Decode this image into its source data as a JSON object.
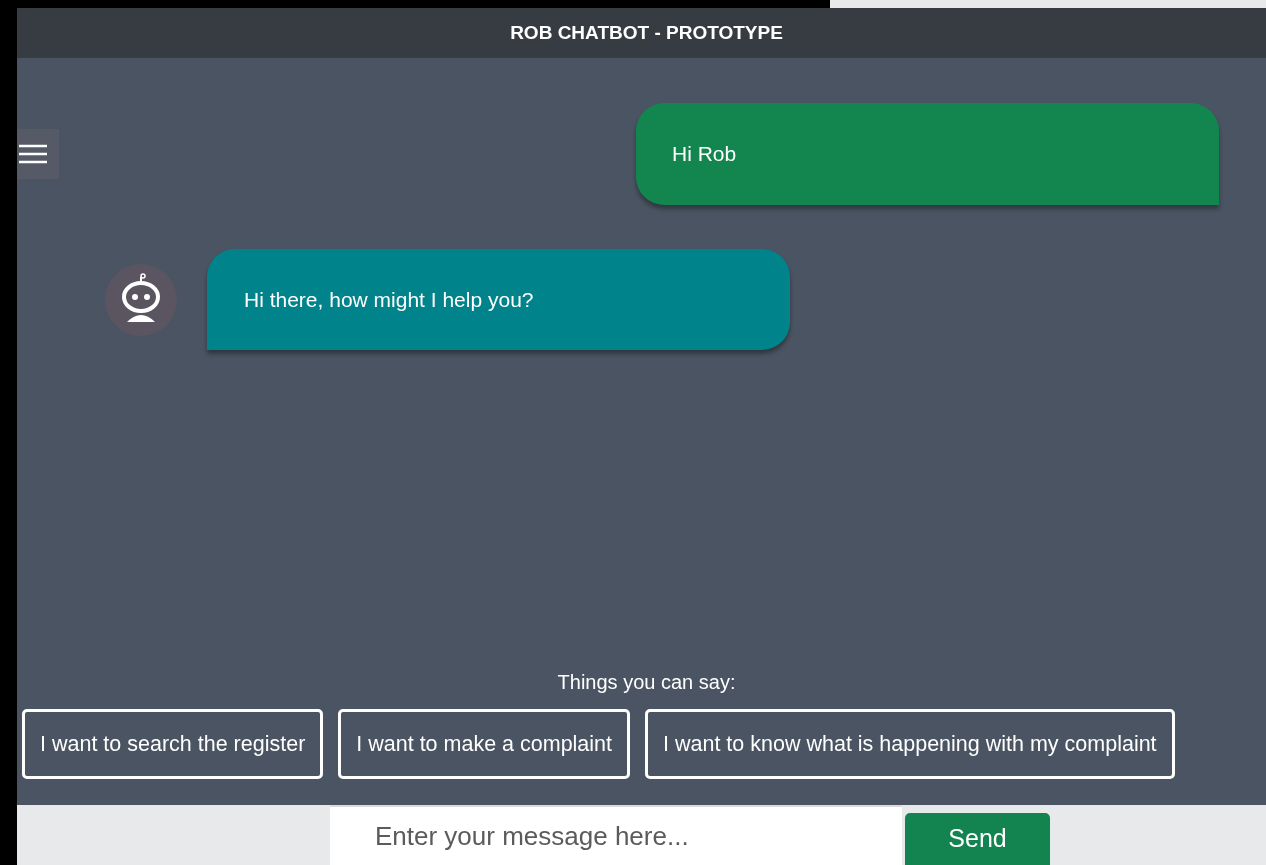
{
  "header": {
    "title": "ROB CHATBOT - PROTOTYPE"
  },
  "messages": [
    {
      "kind": "user",
      "text": "Hi Rob"
    },
    {
      "kind": "bot",
      "text": "Hi there, how might I help you?"
    }
  ],
  "suggestions": {
    "label": "Things you can say:",
    "items": [
      "I want to search the register",
      "I want to make a complaint",
      "I want to know what is happening with my complaint"
    ]
  },
  "composer": {
    "placeholder": "Enter your message here...",
    "send": "Send"
  }
}
